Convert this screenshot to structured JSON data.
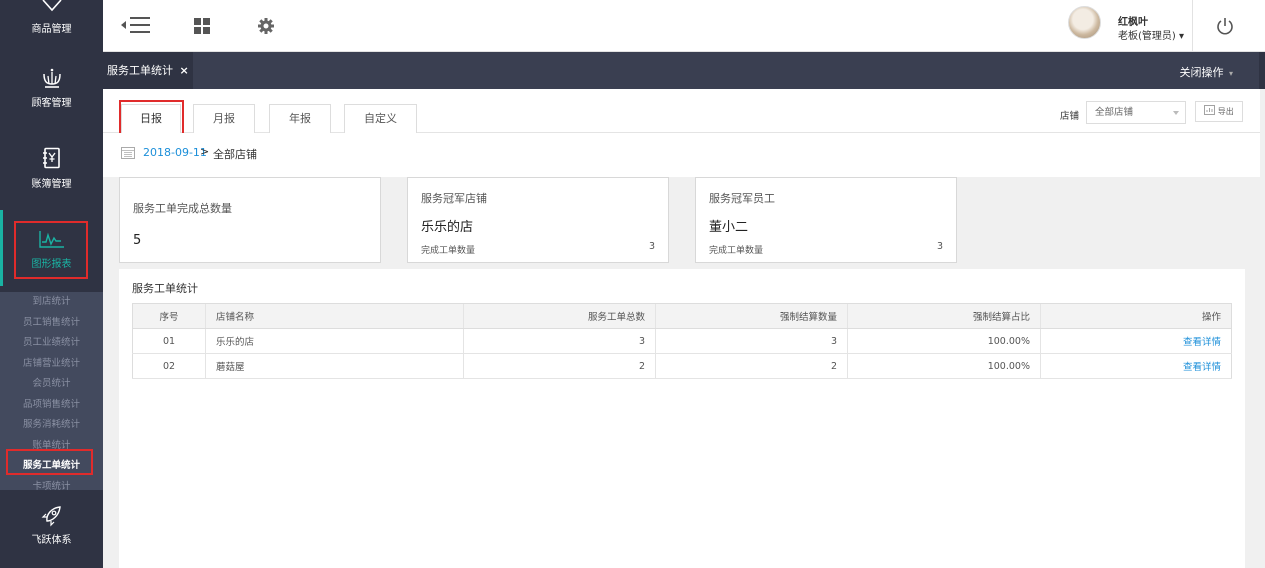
{
  "sidebar": {
    "items": [
      {
        "label": "商品管理",
        "icon": "tag-icon"
      },
      {
        "label": "顾客管理",
        "icon": "crown-icon"
      },
      {
        "label": "账簿管理",
        "icon": "ledger-icon"
      },
      {
        "label": "图形报表",
        "icon": "chart-icon"
      },
      {
        "label": "飞跃体系",
        "icon": "rocket-icon"
      }
    ],
    "sub_items": [
      "到店统计",
      "员工销售统计",
      "员工业绩统计",
      "店铺营业统计",
      "会员统计",
      "品项销售统计",
      "服务消耗统计",
      "账单统计",
      "服务工单统计",
      "卡项统计"
    ],
    "active_sub_index": 8
  },
  "topbar": {
    "user_name": "红枫叶",
    "user_role": "老板(管理员) ▾"
  },
  "tabbar": {
    "tab_label": "服务工单统计",
    "tab_close": "×",
    "close_ops": "关闭操作",
    "close_ops_caret": "▾"
  },
  "filters": {
    "tabs": [
      "日报",
      "月报",
      "年报",
      "自定义"
    ],
    "active_tab": 0,
    "store_label": "店铺",
    "store_value": "全部店铺",
    "export_label": "导出"
  },
  "breadcrumb": {
    "date": "2018-09-11",
    "separator": ">",
    "store": "全部店铺"
  },
  "cards": [
    {
      "title": "服务工单完成总数量",
      "value": "5"
    },
    {
      "title": "服务冠军店铺",
      "value": "乐乐的店",
      "foot_label": "完成工单数量",
      "foot_value": "3"
    },
    {
      "title": "服务冠军员工",
      "value": "董小二",
      "foot_label": "完成工单数量",
      "foot_value": "3"
    }
  ],
  "report": {
    "title": "服务工单统计",
    "columns": [
      "序号",
      "店铺名称",
      "服务工单总数",
      "强制结算数量",
      "强制结算占比",
      "操作"
    ],
    "rows": [
      [
        "01",
        "乐乐的店",
        "3",
        "3",
        "100.00%",
        "查看详情"
      ],
      [
        "02",
        "蘑菇屋",
        "2",
        "2",
        "100.00%",
        "查看详情"
      ]
    ]
  },
  "colors": {
    "sidebar_bg": "#2f3343",
    "accent_teal": "#1ab3a3",
    "link_blue": "#1c8fd9",
    "highlight_red": "#e02b2b"
  }
}
